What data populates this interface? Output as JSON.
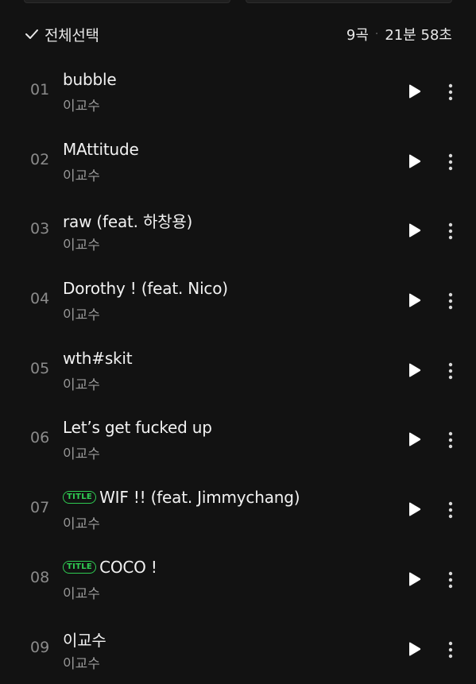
{
  "header": {
    "select_all_label": "전체선택",
    "track_count": "9곡",
    "separator": "·",
    "total_duration": "21분 58초"
  },
  "icons": {
    "check": "check-icon",
    "play": "play-icon",
    "more": "more-vertical-icon"
  },
  "colors": {
    "background": "#121212",
    "title_badge": "#2fcc52",
    "number": "#8b8b8b",
    "artist": "#9a9a9a"
  },
  "tracks": [
    {
      "no": "01",
      "title": "bubble",
      "artist": "이교수",
      "badge": ""
    },
    {
      "no": "02",
      "title": "MAttitude",
      "artist": "이교수",
      "badge": ""
    },
    {
      "no": "03",
      "title": "raw (feat. 하창용)",
      "artist": "이교수",
      "badge": ""
    },
    {
      "no": "04",
      "title": "Dorothy ! (feat. Nico)",
      "artist": "이교수",
      "badge": ""
    },
    {
      "no": "05",
      "title": "wth#skit",
      "artist": "이교수",
      "badge": ""
    },
    {
      "no": "06",
      "title": "Let’s get fucked up",
      "artist": "이교수",
      "badge": ""
    },
    {
      "no": "07",
      "title": "WIF !! (feat. Jimmychang)",
      "artist": "이교수",
      "badge": "TITLE"
    },
    {
      "no": "08",
      "title": "COCO !",
      "artist": "이교수",
      "badge": "TITLE"
    },
    {
      "no": "09",
      "title": "이교수",
      "artist": "이교수",
      "badge": ""
    }
  ]
}
